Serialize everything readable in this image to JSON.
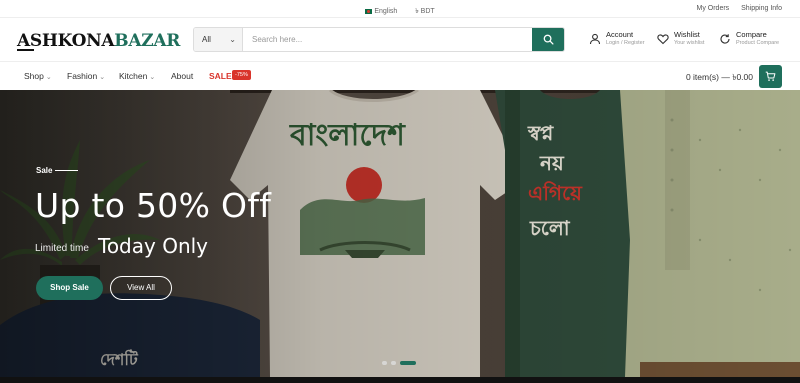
{
  "topbar": {
    "language": "English",
    "currency": "৳ BDT",
    "my_orders": "My Orders",
    "shipping_info": "Shipping Info"
  },
  "header": {
    "logo_part1": "ASHKONA",
    "logo_part2": "BAZAR",
    "search": {
      "category": "All",
      "placeholder": "Search here..."
    },
    "account": {
      "title": "Account",
      "subtitle": "Login / Register"
    },
    "wishlist": {
      "title": "Wishlist",
      "subtitle": "Your wishlist"
    },
    "compare": {
      "title": "Compare",
      "subtitle": "Product Compare"
    }
  },
  "nav": {
    "items": [
      "Shop",
      "Fashion",
      "Kitchen",
      "About"
    ],
    "sale": "SALE",
    "sale_badge": "-75%",
    "cart_summary": "0 item(s) — ৳0.00"
  },
  "hero": {
    "tag": "Sale",
    "title": "Up to 50% Off",
    "limited": "Limited time",
    "today": "Today Only",
    "shop_button": "Shop Sale",
    "view_button": "View All",
    "slides": 3,
    "active_slide": 3
  },
  "colors": {
    "brand": "#1f6f5c",
    "sale": "#d9342b"
  }
}
